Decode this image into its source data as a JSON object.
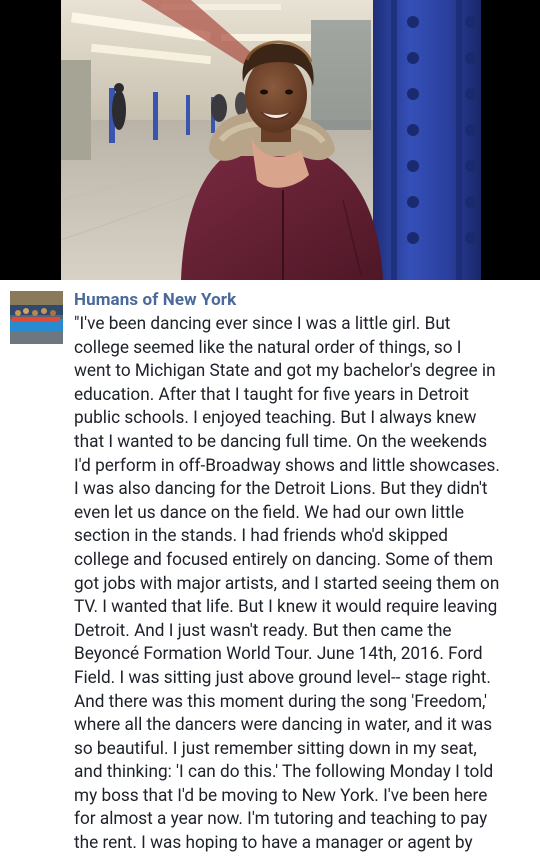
{
  "post": {
    "author": "Humans of New York",
    "lines": [
      "\"I've been dancing ever since I was a little girl. But",
      "college seemed like the natural order of things, so I",
      "went to Michigan State and got my bachelor's degree in",
      "education. After that I taught for five years in Detroit",
      "public schools. I enjoyed teaching. But I always knew",
      "that I wanted to be dancing full time. On the weekends",
      "I'd perform in off-Broadway shows and little showcases.",
      "I was also dancing for the Detroit Lions. But they didn't",
      "even let us dance on the field. We had our own little",
      "section in the stands. I had friends who'd skipped",
      "college and focused entirely on dancing. Some of them",
      "got jobs with major artists, and I started seeing them on",
      "TV. I wanted that life. But I knew it would require leaving",
      "Detroit. And I just wasn't ready. But then came the",
      "Beyoncé Formation World Tour. June 14th, 2016. Ford",
      "Field. I was sitting just above ground level-- stage right.",
      "And there was this moment during the song 'Freedom,'",
      "where all the dancers were dancing in water, and it was",
      "so beautiful. I just remember sitting down in my seat,",
      "and thinking: 'I can do this.' The following Monday I told",
      "my boss that I'd be moving to New York. I've been here",
      "for almost a year now. I'm tutoring and teaching to pay",
      "the rent. I was hoping to have a manager or agent by"
    ]
  },
  "colors": {
    "author": "#4b6a9b",
    "text": "#1d2129",
    "letterbox": "#000000",
    "pillar": "#2a3f9d",
    "coat": "#6b2236"
  }
}
